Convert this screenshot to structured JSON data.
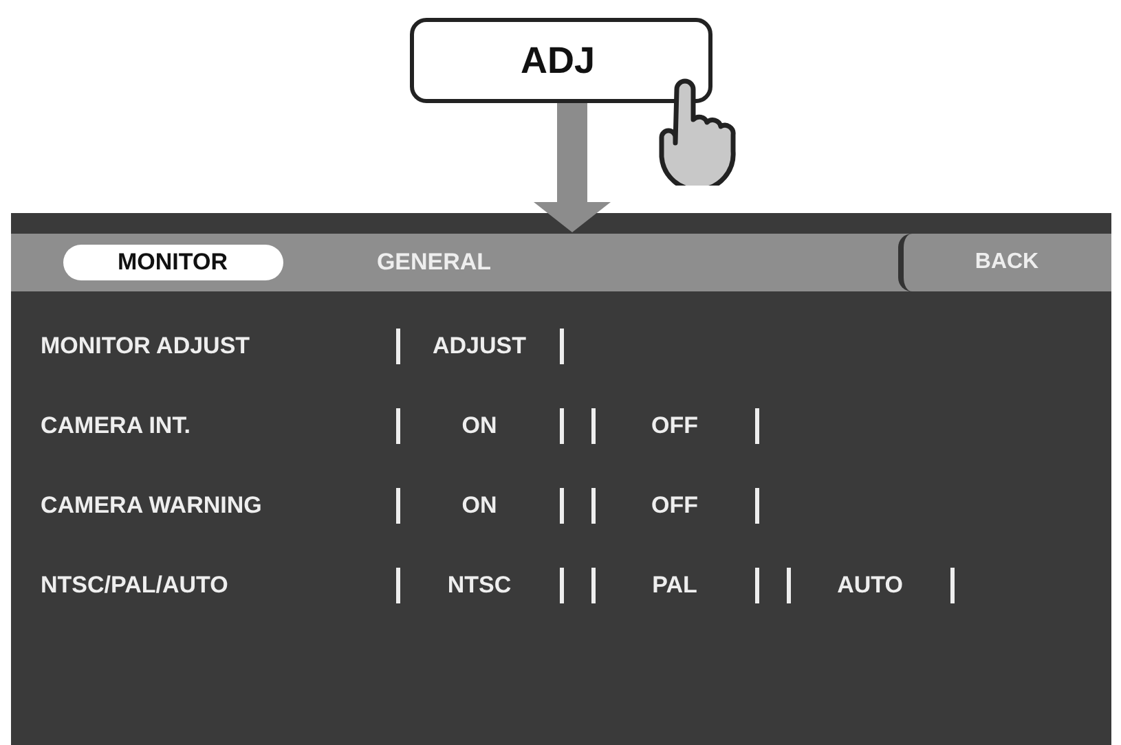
{
  "button": {
    "label": "ADJ"
  },
  "tabs": [
    {
      "label": "MONITOR",
      "selected": true
    },
    {
      "label": "GENERAL",
      "selected": false
    }
  ],
  "back_button": {
    "label": "BACK"
  },
  "settings": [
    {
      "label": "MONITOR ADJUST",
      "options": [
        "ADJUST"
      ]
    },
    {
      "label": "CAMERA INT.",
      "options": [
        "ON",
        "OFF"
      ]
    },
    {
      "label": "CAMERA WARNING",
      "options": [
        "ON",
        "OFF"
      ]
    },
    {
      "label": "NTSC/PAL/AUTO",
      "options": [
        "NTSC",
        "PAL",
        "AUTO"
      ]
    }
  ]
}
